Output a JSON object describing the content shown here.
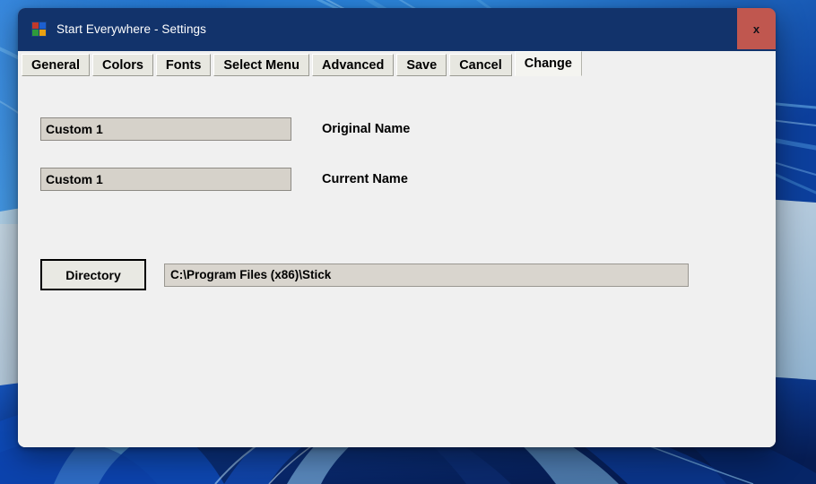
{
  "window": {
    "title": "Start Everywhere - Settings",
    "app_icon": "app-grid-arrows-icon",
    "close_label": "x",
    "titlebar_color": "#12336b",
    "close_button_color": "#c0574f",
    "body_color": "#f0f0f0"
  },
  "tabs": [
    {
      "label": "General",
      "selected": false
    },
    {
      "label": "Colors",
      "selected": false
    },
    {
      "label": "Fonts",
      "selected": false
    },
    {
      "label": "Select Menu",
      "selected": false
    },
    {
      "label": "Advanced",
      "selected": false
    },
    {
      "label": "Save",
      "selected": false
    },
    {
      "label": "Cancel",
      "selected": false
    },
    {
      "label": "Change",
      "selected": true
    }
  ],
  "form": {
    "original_name": {
      "value": "Custom 1",
      "placeholder": "",
      "label": "Original Name"
    },
    "current_name": {
      "value": "Custom 1",
      "placeholder": "",
      "label": "Current Name"
    },
    "directory": {
      "button_label": "Directory",
      "path_value": "C:\\Program Files (x86)\\Stick",
      "placeholder": ""
    }
  }
}
